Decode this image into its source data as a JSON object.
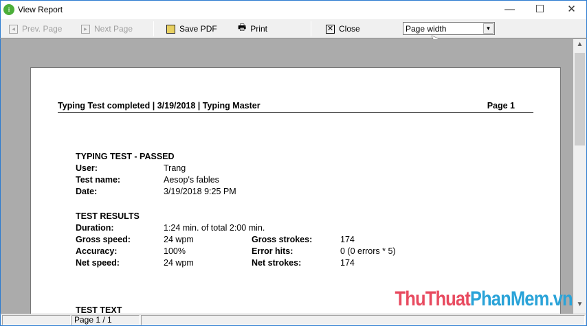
{
  "window": {
    "title": "View Report",
    "minimize": "—",
    "maximize": "☐",
    "close": "✕"
  },
  "toolbar": {
    "prev": "Prev. Page",
    "next": "Next Page",
    "save": "Save PDF",
    "print": "Print",
    "close": "Close",
    "zoom_value": "Page width"
  },
  "report": {
    "header": "Typing Test completed | 3/19/2018 | Typing Master",
    "page": "Page 1",
    "section1": "TYPING TEST - PASSED",
    "info": [
      {
        "k": "User:",
        "v": "Trang"
      },
      {
        "k": "Test name:",
        "v": "Aesop's fables"
      },
      {
        "k": "Date:",
        "v": "3/19/2018 9:25 PM"
      }
    ],
    "section2": "TEST RESULTS",
    "duration": {
      "k": "Duration:",
      "v": "1:24 min.  of total 2:00 min."
    },
    "results": [
      {
        "k": "Gross speed:",
        "v": "24 wpm",
        "k2": "Gross strokes:",
        "v2": "174"
      },
      {
        "k": "Accuracy:",
        "v": "100%",
        "k2": "Error hits:",
        "v2": "0 (0 errors * 5)"
      },
      {
        "k": "Net speed:",
        "v": "24 wpm",
        "k2": "Net strokes:",
        "v2": "174"
      }
    ],
    "section3": "TEST TEXT"
  },
  "watermark": {
    "a": "ThuThuat",
    "b": "PhanMem.vn"
  },
  "status": {
    "page": "Page 1 / 1"
  }
}
